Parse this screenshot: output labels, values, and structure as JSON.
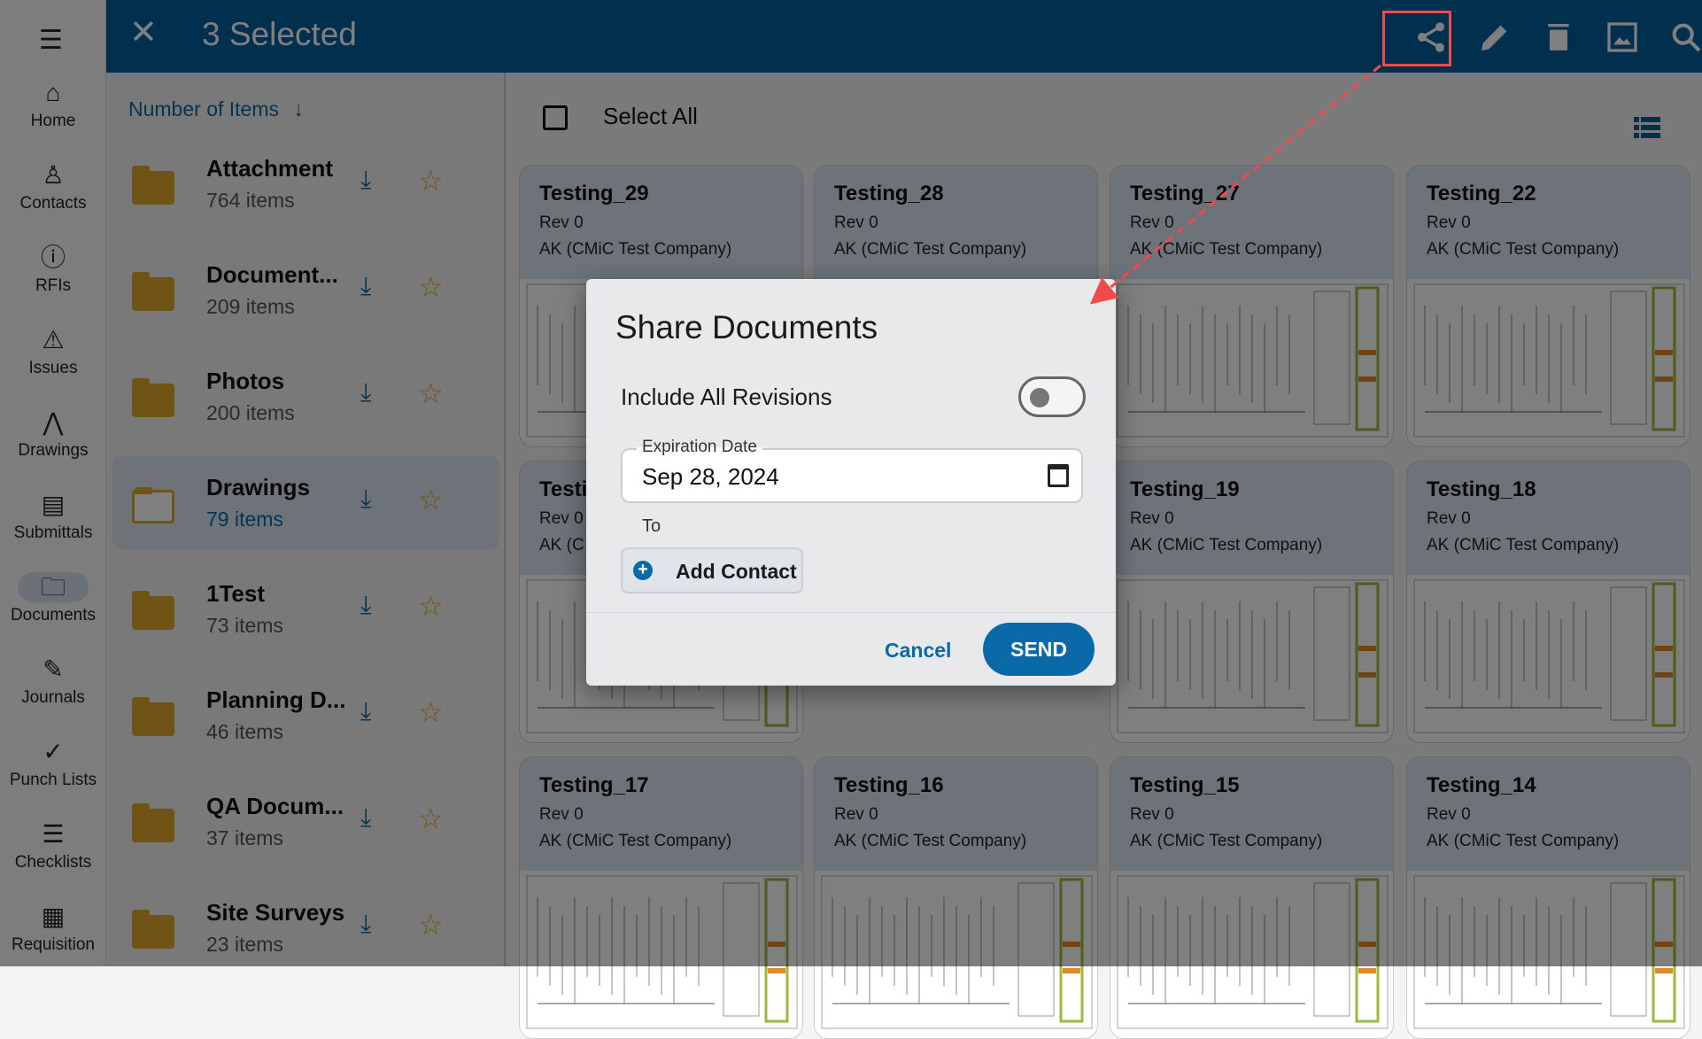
{
  "rail": {
    "items": [
      {
        "label": "Home",
        "icon": "home-icon"
      },
      {
        "label": "Contacts",
        "icon": "person-icon"
      },
      {
        "label": "RFIs",
        "icon": "info-icon"
      },
      {
        "label": "Issues",
        "icon": "warning-icon"
      },
      {
        "label": "Drawings",
        "icon": "compass-icon"
      },
      {
        "label": "Submittals",
        "icon": "document-icon"
      },
      {
        "label": "Documents",
        "icon": "folders-icon",
        "active": true
      },
      {
        "label": "Journals",
        "icon": "journal-icon"
      },
      {
        "label": "Punch Lists",
        "icon": "punch-icon"
      },
      {
        "label": "Checklists",
        "icon": "checklist-icon"
      },
      {
        "label": "Requisition",
        "icon": "requisition-icon"
      }
    ]
  },
  "header": {
    "title": "3 Selected",
    "close": "✕",
    "actions": [
      "share-icon",
      "edit-icon",
      "delete-icon",
      "image-icon",
      "search-icon"
    ],
    "highlight_color": "#f04a4a"
  },
  "folders": {
    "sort_label": "Number of Items",
    "sort_arrow": "↓",
    "items": [
      {
        "name": "Attachment",
        "count": "764 items"
      },
      {
        "name": "Document...",
        "count": "209 items"
      },
      {
        "name": "Photos",
        "count": "200 items"
      },
      {
        "name": "Drawings",
        "count": "79 items",
        "selected": true
      },
      {
        "name": "1Test",
        "count": "73 items"
      },
      {
        "name": "Planning D...",
        "count": "46 items"
      },
      {
        "name": "QA Docum...",
        "count": "37 items"
      },
      {
        "name": "Site Surveys",
        "count": "23 items"
      }
    ]
  },
  "grid": {
    "select_all": "Select All",
    "cards": [
      {
        "title": "Testing_29",
        "rev": "Rev 0",
        "company": "AK (CMiC Test Company)"
      },
      {
        "title": "Testing_28",
        "rev": "Rev 0",
        "company": "AK (CMiC Test Company)"
      },
      {
        "title": "Testing_27",
        "rev": "Rev 0",
        "company": "AK (CMiC Test Company)"
      },
      {
        "title": "Testing_22",
        "rev": "Rev 0",
        "company": "AK (CMiC Test Company)"
      },
      {
        "title": "Testi",
        "rev": "Rev 0",
        "company": "AK (C"
      },
      {
        "title": "",
        "rev": "",
        "company": ""
      },
      {
        "title": "Testing_19",
        "rev": "Rev 0",
        "company": "AK (CMiC Test Company)"
      },
      {
        "title": "Testing_18",
        "rev": "Rev 0",
        "company": "AK (CMiC Test Company)"
      },
      {
        "title": "Testing_17",
        "rev": "Rev 0",
        "company": "AK (CMiC Test Company)"
      },
      {
        "title": "Testing_16",
        "rev": "Rev 0",
        "company": "AK (CMiC Test Company)"
      },
      {
        "title": "Testing_15",
        "rev": "Rev 0",
        "company": "AK (CMiC Test Company)"
      },
      {
        "title": "Testing_14",
        "rev": "Rev 0",
        "company": "AK (CMiC Test Company)"
      }
    ]
  },
  "dialog": {
    "title": "Share Documents",
    "include_revisions_label": "Include All Revisions",
    "include_revisions": false,
    "expiration_label": "Expiration Date",
    "expiration_value": "Sep 28, 2024",
    "to_label": "To",
    "add_contact": "Add Contact",
    "cancel": "Cancel",
    "send": "SEND"
  },
  "colors": {
    "header": "#00609a",
    "accent": "#0a6aa8",
    "folder": "#e0a92a"
  }
}
